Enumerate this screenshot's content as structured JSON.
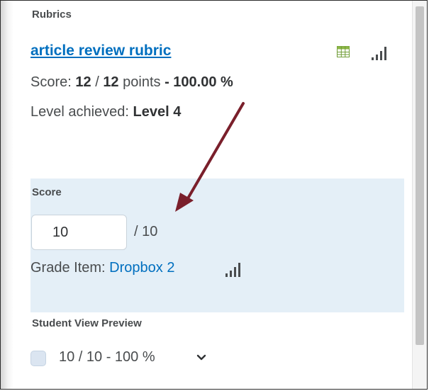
{
  "rubrics": {
    "section_label": "Rubrics",
    "rubric_name": "article review rubric",
    "icons": {
      "grid": "rubric-grid-icon",
      "levels": "signal-bars-icon"
    },
    "score": {
      "label": "Score:",
      "earned": "12",
      "separator": "/",
      "total": "12",
      "unit": "points",
      "dash": "-",
      "percent": "100.00 %"
    },
    "level": {
      "label": "Level achieved:",
      "value": "Level 4"
    }
  },
  "score_section": {
    "label": "Score",
    "input_value": "10",
    "out_of": "/ 10",
    "grade_item_label": "Grade Item:",
    "grade_item_link": "Dropbox 2",
    "icon": "signal-bars-icon"
  },
  "preview": {
    "label": "Student View Preview",
    "value": "10 / 10 - 100 %",
    "icon": "chevron-down-icon"
  },
  "colors": {
    "link": "#006fbf",
    "score_bg": "#e4eff7",
    "arrow": "#7a1f2b",
    "text": "#494c4e"
  }
}
